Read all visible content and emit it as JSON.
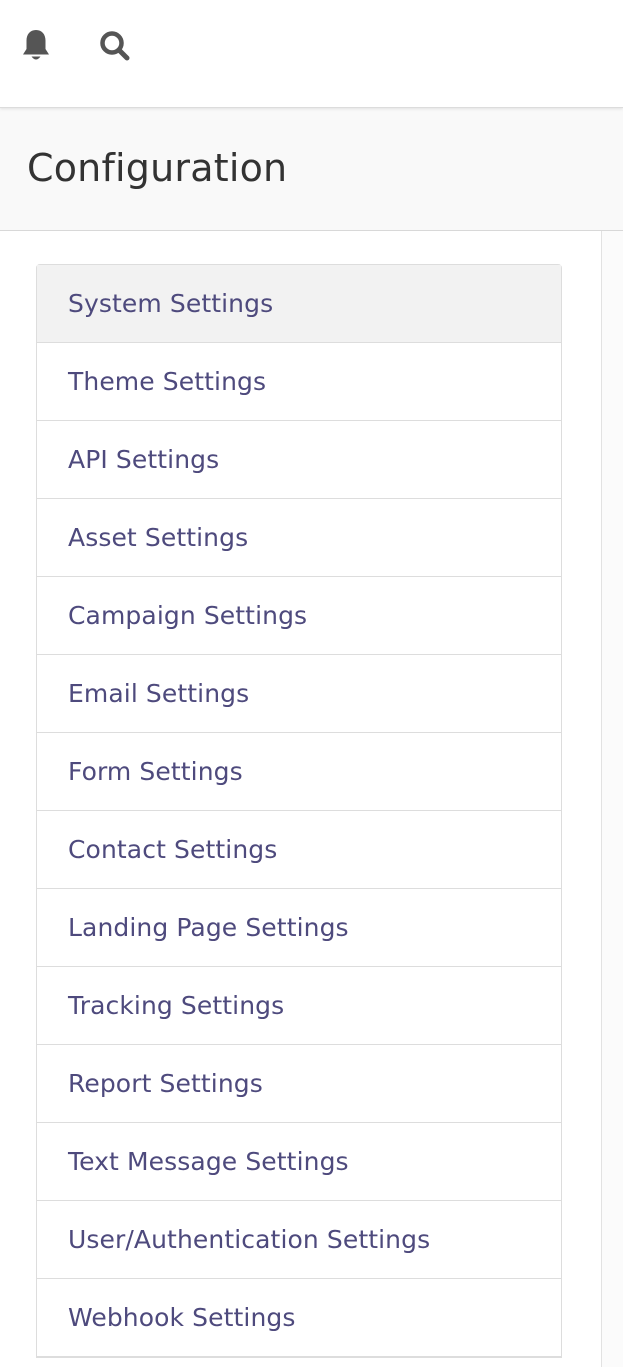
{
  "topbar": {
    "icons": [
      "bell-icon",
      "search-icon"
    ]
  },
  "page": {
    "title": "Configuration"
  },
  "colors": {
    "link": "#4e4a7d",
    "active_bg": "#f2f2f2",
    "border": "#dddddd"
  },
  "settings": {
    "active_index": 0,
    "items": [
      {
        "label": "System Settings"
      },
      {
        "label": "Theme Settings"
      },
      {
        "label": "API Settings"
      },
      {
        "label": "Asset Settings"
      },
      {
        "label": "Campaign Settings"
      },
      {
        "label": "Email Settings"
      },
      {
        "label": "Form Settings"
      },
      {
        "label": "Contact Settings"
      },
      {
        "label": "Landing Page Settings"
      },
      {
        "label": "Tracking Settings"
      },
      {
        "label": "Report Settings"
      },
      {
        "label": "Text Message Settings"
      },
      {
        "label": "User/Authentication Settings"
      },
      {
        "label": "Webhook Settings"
      }
    ]
  }
}
